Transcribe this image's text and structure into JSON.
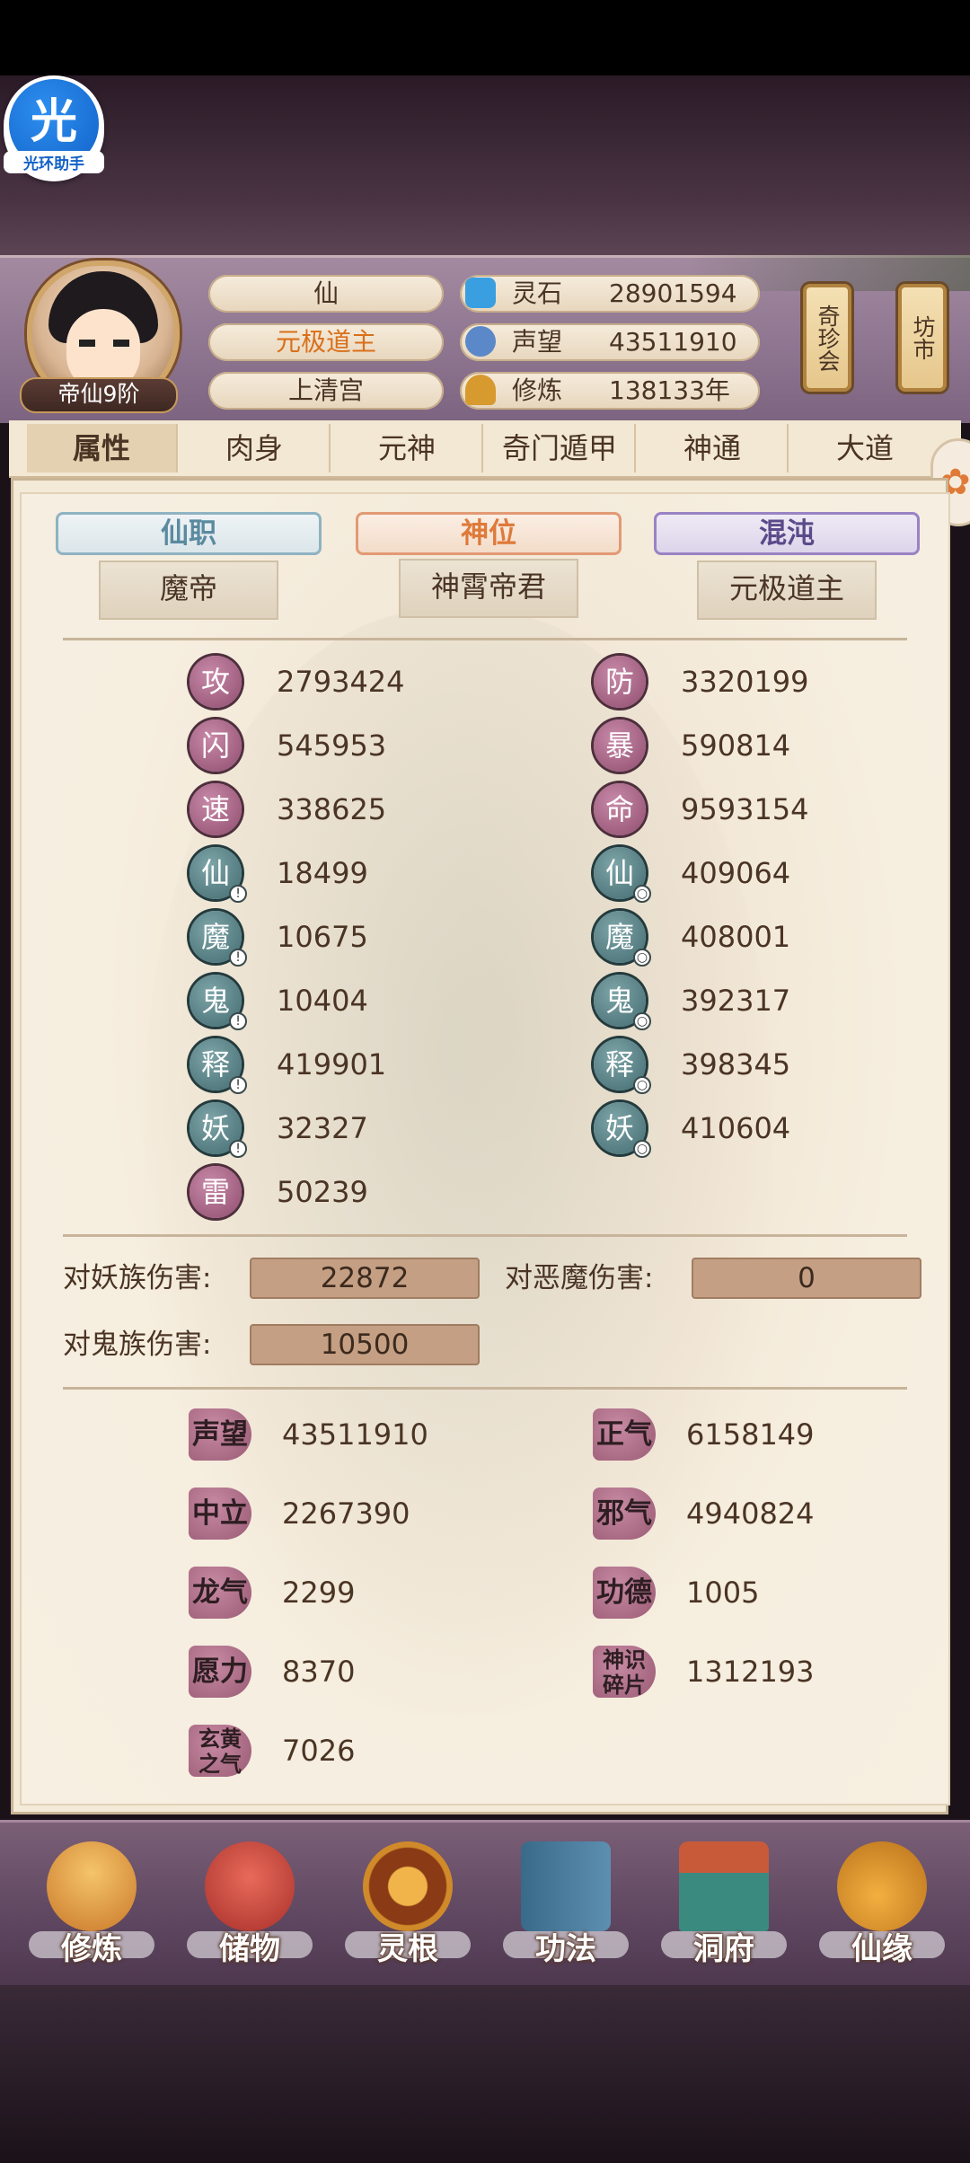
{
  "helper": {
    "glyph": "光",
    "caption": "光环助手"
  },
  "header": {
    "rank": "帝仙9阶",
    "pills": [
      "仙",
      "元极道主",
      "上清宫"
    ],
    "resources": [
      {
        "label": "灵石",
        "value": "28901594",
        "icon": "spirit-stone-icon",
        "color": "#3a9fe0"
      },
      {
        "label": "声望",
        "value": "43511910",
        "icon": "prestige-icon",
        "color": "#5a88c8"
      },
      {
        "label": "修炼",
        "value": "138133年",
        "icon": "meditation-icon",
        "color": "#d69a2e"
      }
    ],
    "signs": [
      "奇珍会",
      "坊市"
    ]
  },
  "tabs": [
    "属性",
    "肉身",
    "元神",
    "奇门遁甲",
    "神通",
    "大道"
  ],
  "titles": [
    {
      "banner": "仙职",
      "value": "魔帝"
    },
    {
      "banner": "神位",
      "value": "神霄帝君"
    },
    {
      "banner": "混沌",
      "value": "元极道主"
    }
  ],
  "stats_left": [
    {
      "icon": "攻",
      "value": "2793424"
    },
    {
      "icon": "闪",
      "value": "545953"
    },
    {
      "icon": "速",
      "value": "338625"
    },
    {
      "icon": "仙",
      "value": "18499"
    },
    {
      "icon": "魔",
      "value": "10675"
    },
    {
      "icon": "鬼",
      "value": "10404"
    },
    {
      "icon": "释",
      "value": "419901"
    },
    {
      "icon": "妖",
      "value": "32327"
    },
    {
      "icon": "雷",
      "value": "50239"
    }
  ],
  "stats_right": [
    {
      "icon": "防",
      "value": "3320199"
    },
    {
      "icon": "暴",
      "value": "590814"
    },
    {
      "icon": "命",
      "value": "9593154"
    },
    {
      "icon": "仙",
      "value": "409064"
    },
    {
      "icon": "魔",
      "value": "408001"
    },
    {
      "icon": "鬼",
      "value": "392317"
    },
    {
      "icon": "释",
      "value": "398345"
    },
    {
      "icon": "妖",
      "value": "410604"
    }
  ],
  "damage": {
    "yao_label": "对妖族伤害:",
    "yao_value": "22872",
    "emo_label": "对恶魔伤害:",
    "emo_value": "0",
    "gui_label": "对鬼族伤害:",
    "gui_value": "10500"
  },
  "resources_left": [
    {
      "icon": "声望",
      "value": "43511910"
    },
    {
      "icon": "中立",
      "value": "2267390"
    },
    {
      "icon": "龙气",
      "value": "2299"
    },
    {
      "icon": "愿力",
      "value": "8370"
    },
    {
      "icon": "玄黄之气",
      "value": "7026"
    }
  ],
  "resources_right": [
    {
      "icon": "正气",
      "value": "6158149"
    },
    {
      "icon": "邪气",
      "value": "4940824"
    },
    {
      "icon": "功德",
      "value": "1005"
    },
    {
      "icon": "神识碎片",
      "value": "1312193"
    }
  ],
  "nav": [
    "修炼",
    "储物",
    "灵根",
    "功法",
    "洞府",
    "仙缘"
  ]
}
